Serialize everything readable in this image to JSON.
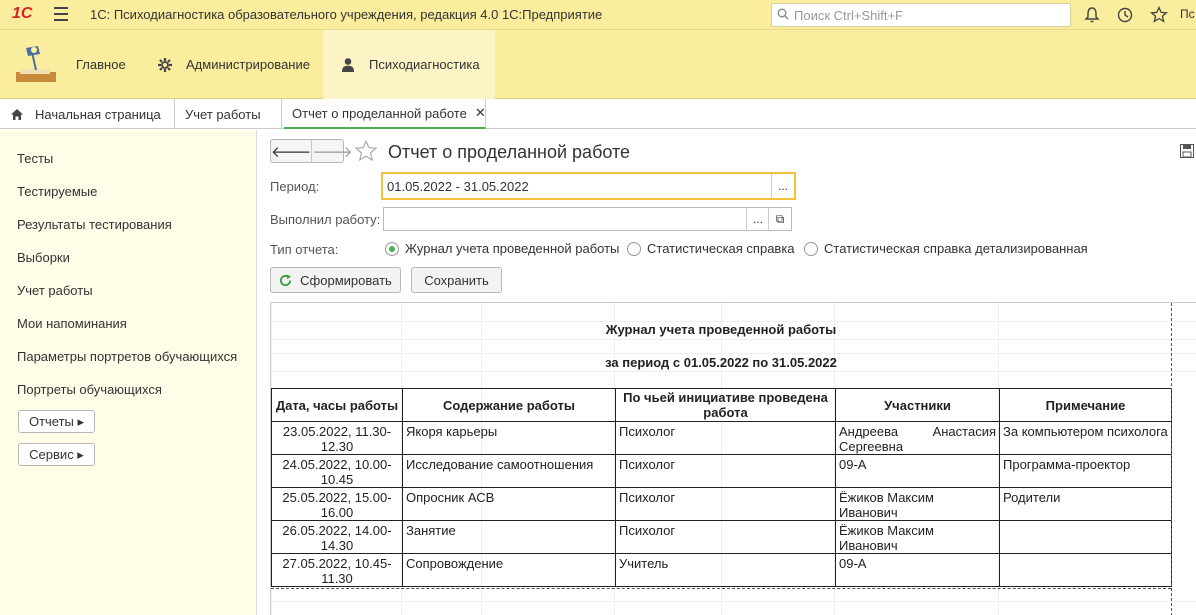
{
  "titlebar": {
    "logo": "1С",
    "title": "1С: Психодиагностика образовательного учреждения, редакция 4.0 1С:Предприятие",
    "search_placeholder": "Поиск Ctrl+Shift+F",
    "user": "Пс"
  },
  "sections": [
    {
      "label": "Главное",
      "icon": "desk-lamp-icon"
    },
    {
      "label": "Администрирование",
      "icon": "gear-icon"
    },
    {
      "label": "Психодиагностика",
      "icon": "person-icon"
    }
  ],
  "tabs": [
    {
      "label": "Начальная страница",
      "icon": "home-icon"
    },
    {
      "label": "Учет работы"
    },
    {
      "label": "Отчет о проделанной работе",
      "active": true
    }
  ],
  "leftmenu": {
    "items": [
      "Тесты",
      "Тестируемые",
      "Результаты тестирования",
      "Выборки",
      "Учет работы",
      "Мои напоминания",
      "Параметры портретов обучающихся",
      "Портреты обучающихся"
    ],
    "reports_button": "Отчеты ▸",
    "service_button": "Сервис ▸"
  },
  "form": {
    "title": "Отчет о проделанной работе",
    "period_label": "Период:",
    "period_value": "01.05.2022 - 31.05.2022",
    "performer_label": "Выполнил работу:",
    "performer_value": "",
    "report_type_label": "Тип отчета:",
    "report_types": [
      "Журнал учета проведенной работы",
      "Статистическая справка",
      "Статистическая справка детализированная"
    ],
    "selected_report_type": 0,
    "generate_button": "Сформировать",
    "save_button": "Сохранить",
    "ellipsis": "...",
    "open_icon": "⧉"
  },
  "report": {
    "title": "Журнал учета проведенной работы",
    "subtitle": "за период с 01.05.2022 по 31.05.2022",
    "columns": [
      "Дата, часы работы",
      "Содержание работы",
      "По чьей инициативе проведена работа",
      "Участники",
      "Примечание"
    ],
    "rows": [
      {
        "date": "23.05.2022, 11.30-12.30",
        "content": "Якоря карьеры",
        "initiative": "Психолог",
        "participants": "Андреева Анастасия Сергеевна",
        "note": "За компьютером психолога"
      },
      {
        "date": "24.05.2022, 10.00-10.45",
        "content": "Исследование самоотношения",
        "initiative": "Психолог",
        "participants": "09-А",
        "note": "Программа-проектор"
      },
      {
        "date": "25.05.2022, 15.00-16.00",
        "content": "Опросник АСВ",
        "initiative": "Психолог",
        "participants": "Ёжиков Максим Иванович",
        "note": "Родители"
      },
      {
        "date": "26.05.2022, 14.00-14.30",
        "content": "Занятие",
        "initiative": "Психолог",
        "participants": "Ёжиков Максим Иванович",
        "note": ""
      },
      {
        "date": "27.05.2022, 10.45-11.30",
        "content": "Сопровождение",
        "initiative": "Учитель",
        "participants": "09-А",
        "note": ""
      }
    ]
  },
  "colors": {
    "panel": "#fbed9e",
    "active_section": "#fdf4c5",
    "leftmenu_bg": "#fffde8",
    "accent_green": "#4caf50",
    "focus_yellow": "#f2c335"
  }
}
